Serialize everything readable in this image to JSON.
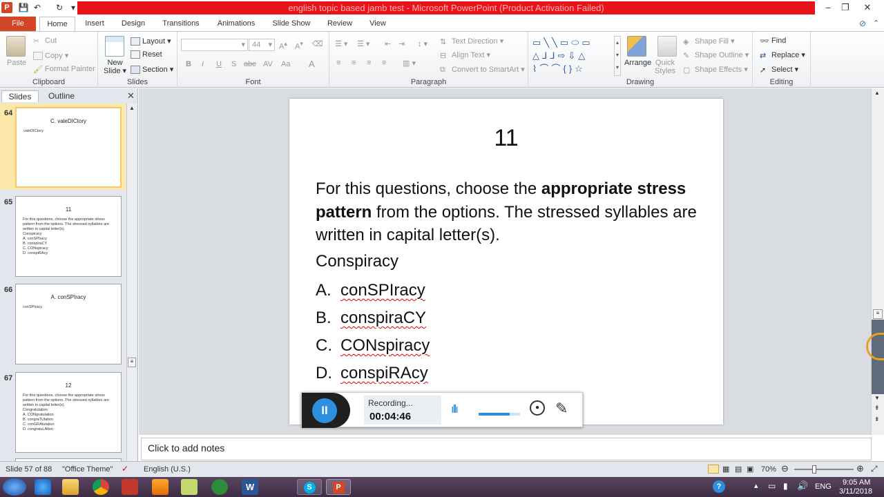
{
  "window": {
    "title": "english topic based jamb test  -  Microsoft PowerPoint (Product Activation Failed)",
    "controls": [
      "–",
      "❐",
      "✕"
    ]
  },
  "ribbon_tabs": [
    "File",
    "Home",
    "Insert",
    "Design",
    "Transitions",
    "Animations",
    "Slide Show",
    "Review",
    "View"
  ],
  "active_tab": "Home",
  "clipboard": {
    "paste": "Paste",
    "cut": "Cut",
    "copy": "Copy",
    "format_painter": "Format Painter",
    "label": "Clipboard"
  },
  "slides_group": {
    "new_slide_line1": "New",
    "new_slide_line2": "Slide",
    "layout": "Layout",
    "reset": "Reset",
    "section": "Section",
    "label": "Slides"
  },
  "font_group": {
    "font_size": "44",
    "label": "Font"
  },
  "paragraph_group": {
    "text_direction": "Text Direction",
    "align_text": "Align Text",
    "convert_smartart": "Convert to SmartArt",
    "label": "Paragraph"
  },
  "drawing_group": {
    "arrange": "Arrange",
    "quick_styles_line1": "Quick",
    "quick_styles_line2": "Styles",
    "shape_fill": "Shape Fill",
    "shape_outline": "Shape Outline",
    "shape_effects": "Shape Effects",
    "label": "Drawing"
  },
  "editing_group": {
    "find": "Find",
    "replace": "Replace",
    "select": "Select",
    "label": "Editing"
  },
  "pane_tabs": {
    "slides": "Slides",
    "outline": "Outline"
  },
  "thumbnails": [
    {
      "num": "64",
      "title": "C. valeDICtory",
      "body": [
        "valeDICtory"
      ]
    },
    {
      "num": "65",
      "title": "11",
      "body": [
        "For this questions, choose the appropriate stress pattern from the options. The stressed syllables are written in capital letter(s).",
        "Conspiracy",
        "A.  conSPIracy",
        "B.  conspiraCY",
        "C.  CONspiracy",
        "D.  conspiRAcy"
      ]
    },
    {
      "num": "66",
      "title": "A. conSPIracy",
      "body": [
        "conSPIracy"
      ]
    },
    {
      "num": "67",
      "title": "12",
      "body": [
        "For this questions, choose the appropriate stress pattern from the options. The stressed syllables are written in capital letter(s).",
        "Congratulation",
        "A.  CONgratulation",
        "B.  congraTUlation",
        "C.  conGRAtulation",
        "D.  congratuLAtion"
      ]
    }
  ],
  "slide": {
    "number": "11",
    "question_start": "For this questions, choose the ",
    "question_bold1": "appropriate stress pattern",
    "question_end": " from the options. The stressed syllables are written in capital letter(s).",
    "word": "Conspiracy",
    "options": [
      {
        "letter": "A.",
        "text": "conSPIracy"
      },
      {
        "letter": "B.",
        "text": "conspiraCY"
      },
      {
        "letter": "C.",
        "text": "CONspiracy"
      },
      {
        "letter": "D.",
        "text": "conspiRAcy"
      }
    ]
  },
  "recorder": {
    "status": "Recording...",
    "time": "00:04:46",
    "volume_level": 0.75
  },
  "notes_placeholder": "Click to add notes",
  "statusbar": {
    "slide_info": "Slide 57 of 88",
    "theme": "\"Office Theme\"",
    "language": "English (U.S.)",
    "zoom": "70%"
  },
  "taskbar": {
    "lang": "ENG",
    "time": "9:05 AM",
    "date": "3/11/2018"
  },
  "colors": {
    "title_red": "#e8141a",
    "file_tab": "#d24726",
    "pause_blue": "#2d8fe0"
  }
}
